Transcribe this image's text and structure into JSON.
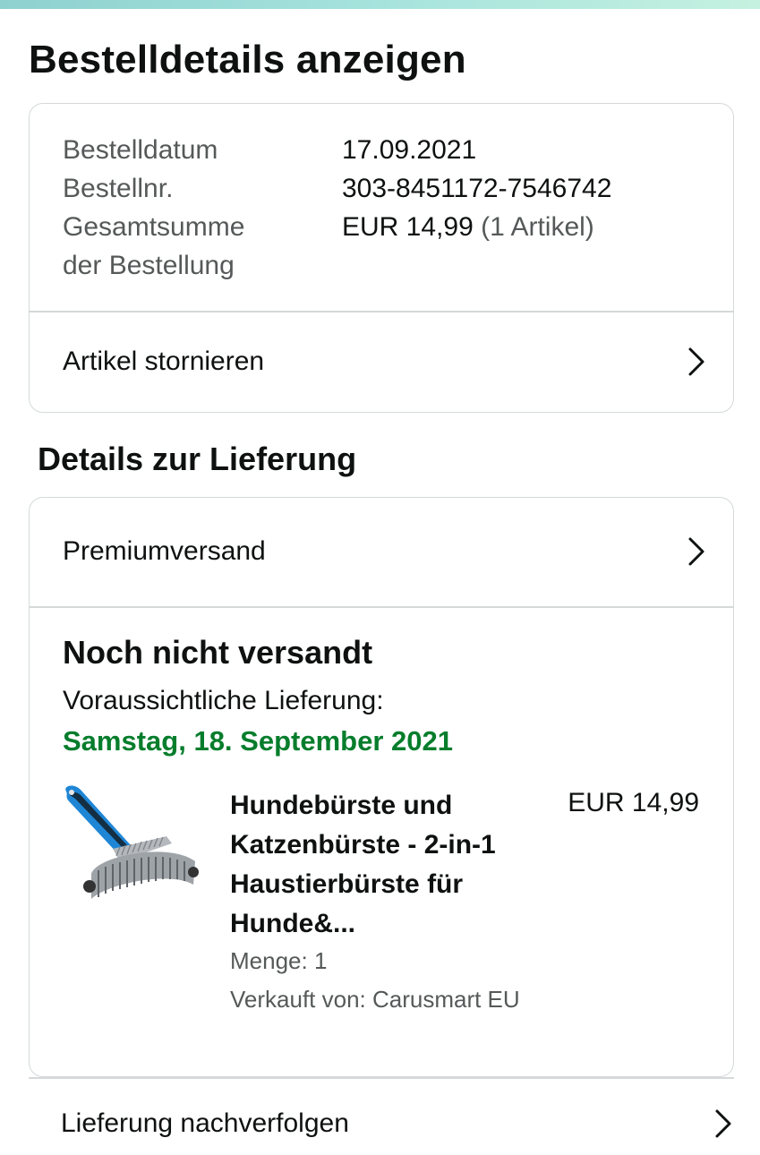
{
  "page": {
    "title": "Bestelldetails anzeigen"
  },
  "summary": {
    "rows": [
      {
        "label": "Bestelldatum",
        "value": "17.09.2021"
      },
      {
        "label": "Bestellnr.",
        "value": "303-8451172-7546742"
      },
      {
        "label_line1": "Gesamtsumme",
        "label_line2": "der Bestellung",
        "value": "EUR 14,99",
        "value_suffix": "(1 Artikel)"
      }
    ],
    "cancel_label": "Artikel stornieren"
  },
  "delivery": {
    "section_title": "Details zur Lieferung",
    "shipping_method": "Premiumversand",
    "status": "Noch nicht versandt",
    "expected_label": "Voraussichtliche Lieferung:",
    "expected_date": "Samstag, 18. September 2021",
    "product": {
      "title_lines": [
        "Hundebürste und",
        "Katzenbürste - 2-in-1",
        "Haustierbürste für",
        "Hunde&..."
      ],
      "price": "EUR 14,99",
      "quantity": "Menge: 1",
      "seller": "Verkauft von: Carusmart EU",
      "image_icon": "pet-grooming-brush"
    },
    "track_label": "Lieferung nachverfolgen"
  },
  "colors": {
    "accent_green": "#067d2c",
    "muted_text": "#565959",
    "border": "#d5d9d9",
    "brush_blue": "#1f86d6"
  }
}
